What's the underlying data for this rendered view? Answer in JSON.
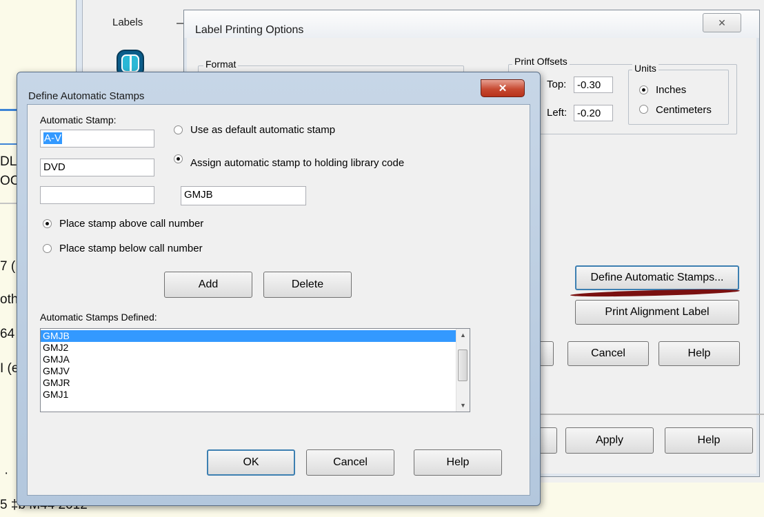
{
  "background": {
    "fragments": [
      "DL",
      "OC",
      "7 (",
      "oth",
      "64",
      "I (e",
      "·",
      "5 ‡b M44 2012"
    ]
  },
  "labels_window": {
    "title": "Labels",
    "icon": "labels-app-icon"
  },
  "label_printing_options": {
    "title": "Label Printing Options",
    "close_label": "✕",
    "format_group": "Format",
    "print_offsets_group": "Print Offsets",
    "top_label": "Top:",
    "top_value": "-0.30",
    "left_label": "Left:",
    "left_value": "-0.20",
    "units_group": "Units",
    "units_options": [
      "Inches",
      "Centimeters"
    ],
    "units_selected": "Inches",
    "define_stamps_button": "Define Automatic Stamps...",
    "print_alignment_button": "Print Alignment Label",
    "cancel_button": "Cancel",
    "help_button": "Help",
    "apply_button": "Apply",
    "help_button_2": "Help"
  },
  "define_automatic_stamps": {
    "title": "Define Automatic Stamps",
    "close_label": "✕",
    "automatic_stamp_label": "Automatic Stamp:",
    "stamp_line_1": "A-V",
    "stamp_line_2": "DVD",
    "stamp_line_3": "",
    "use_default_label": "Use as default automatic stamp",
    "assign_label": "Assign automatic stamp to holding library code",
    "library_code": "GMJB",
    "place_above_label": "Place stamp above call number",
    "place_below_label": "Place stamp below call number",
    "add_button": "Add",
    "delete_button": "Delete",
    "defined_label": "Automatic Stamps Defined:",
    "defined_list": [
      "GMJB",
      "GMJ2",
      "GMJA",
      "GMJV",
      "GMJR",
      "GMJ1"
    ],
    "selected_item": "GMJB",
    "ok_button": "OK",
    "cancel_button": "Cancel",
    "help_button": "Help"
  },
  "colors": {
    "selection": "#3399ff",
    "annotation_underline": "#7a1010",
    "title_bar": "#c7d6e7"
  }
}
